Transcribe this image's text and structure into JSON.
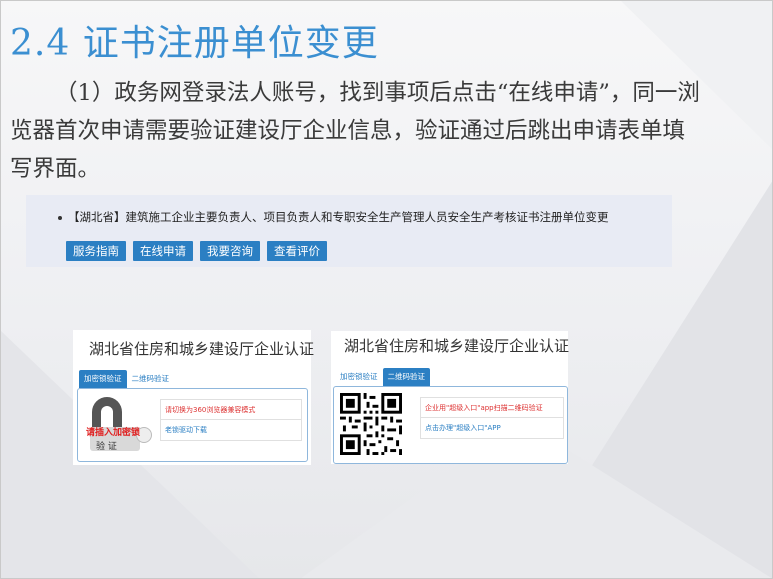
{
  "slide": {
    "title": "2.4 证书注册单位变更",
    "paragraph": "（1）政务网登录法人账号，找到事项后点击“在线申请”，同一浏览器首次申请需要验证建设厅企业信息，验证通过后跳出申请表单填写界面。"
  },
  "notice": {
    "item_text": "【湖北省】建筑施工企业主要负责人、项目负责人和专职安全生产管理人员安全生产考核证书注册单位变更",
    "buttons": [
      "服务指南",
      "在线申请",
      "我要咨询",
      "查看评价"
    ]
  },
  "panel_left": {
    "title": "湖北省住房和城乡建设厅企业认证",
    "tabs": [
      "加密锁验证",
      "二维码验证"
    ],
    "active_tab": 0,
    "options": [
      "请切换为360浏览器兼容模式",
      "老锁驱动下载"
    ],
    "usb_prompt": "请插入加密锁",
    "usb_verify": "验 证"
  },
  "panel_right": {
    "title": "湖北省住房和城乡建设厅企业认证",
    "tabs": [
      "加密锁验证",
      "二维码验证"
    ],
    "active_tab": 1,
    "options": [
      "企业用\"超级入口\"app扫描二维码验证",
      "点击办理\"超级入口\"APP"
    ]
  },
  "colors": {
    "title": "#3b8fd1",
    "accent": "#2b7fc3",
    "warning": "#dd3333"
  }
}
